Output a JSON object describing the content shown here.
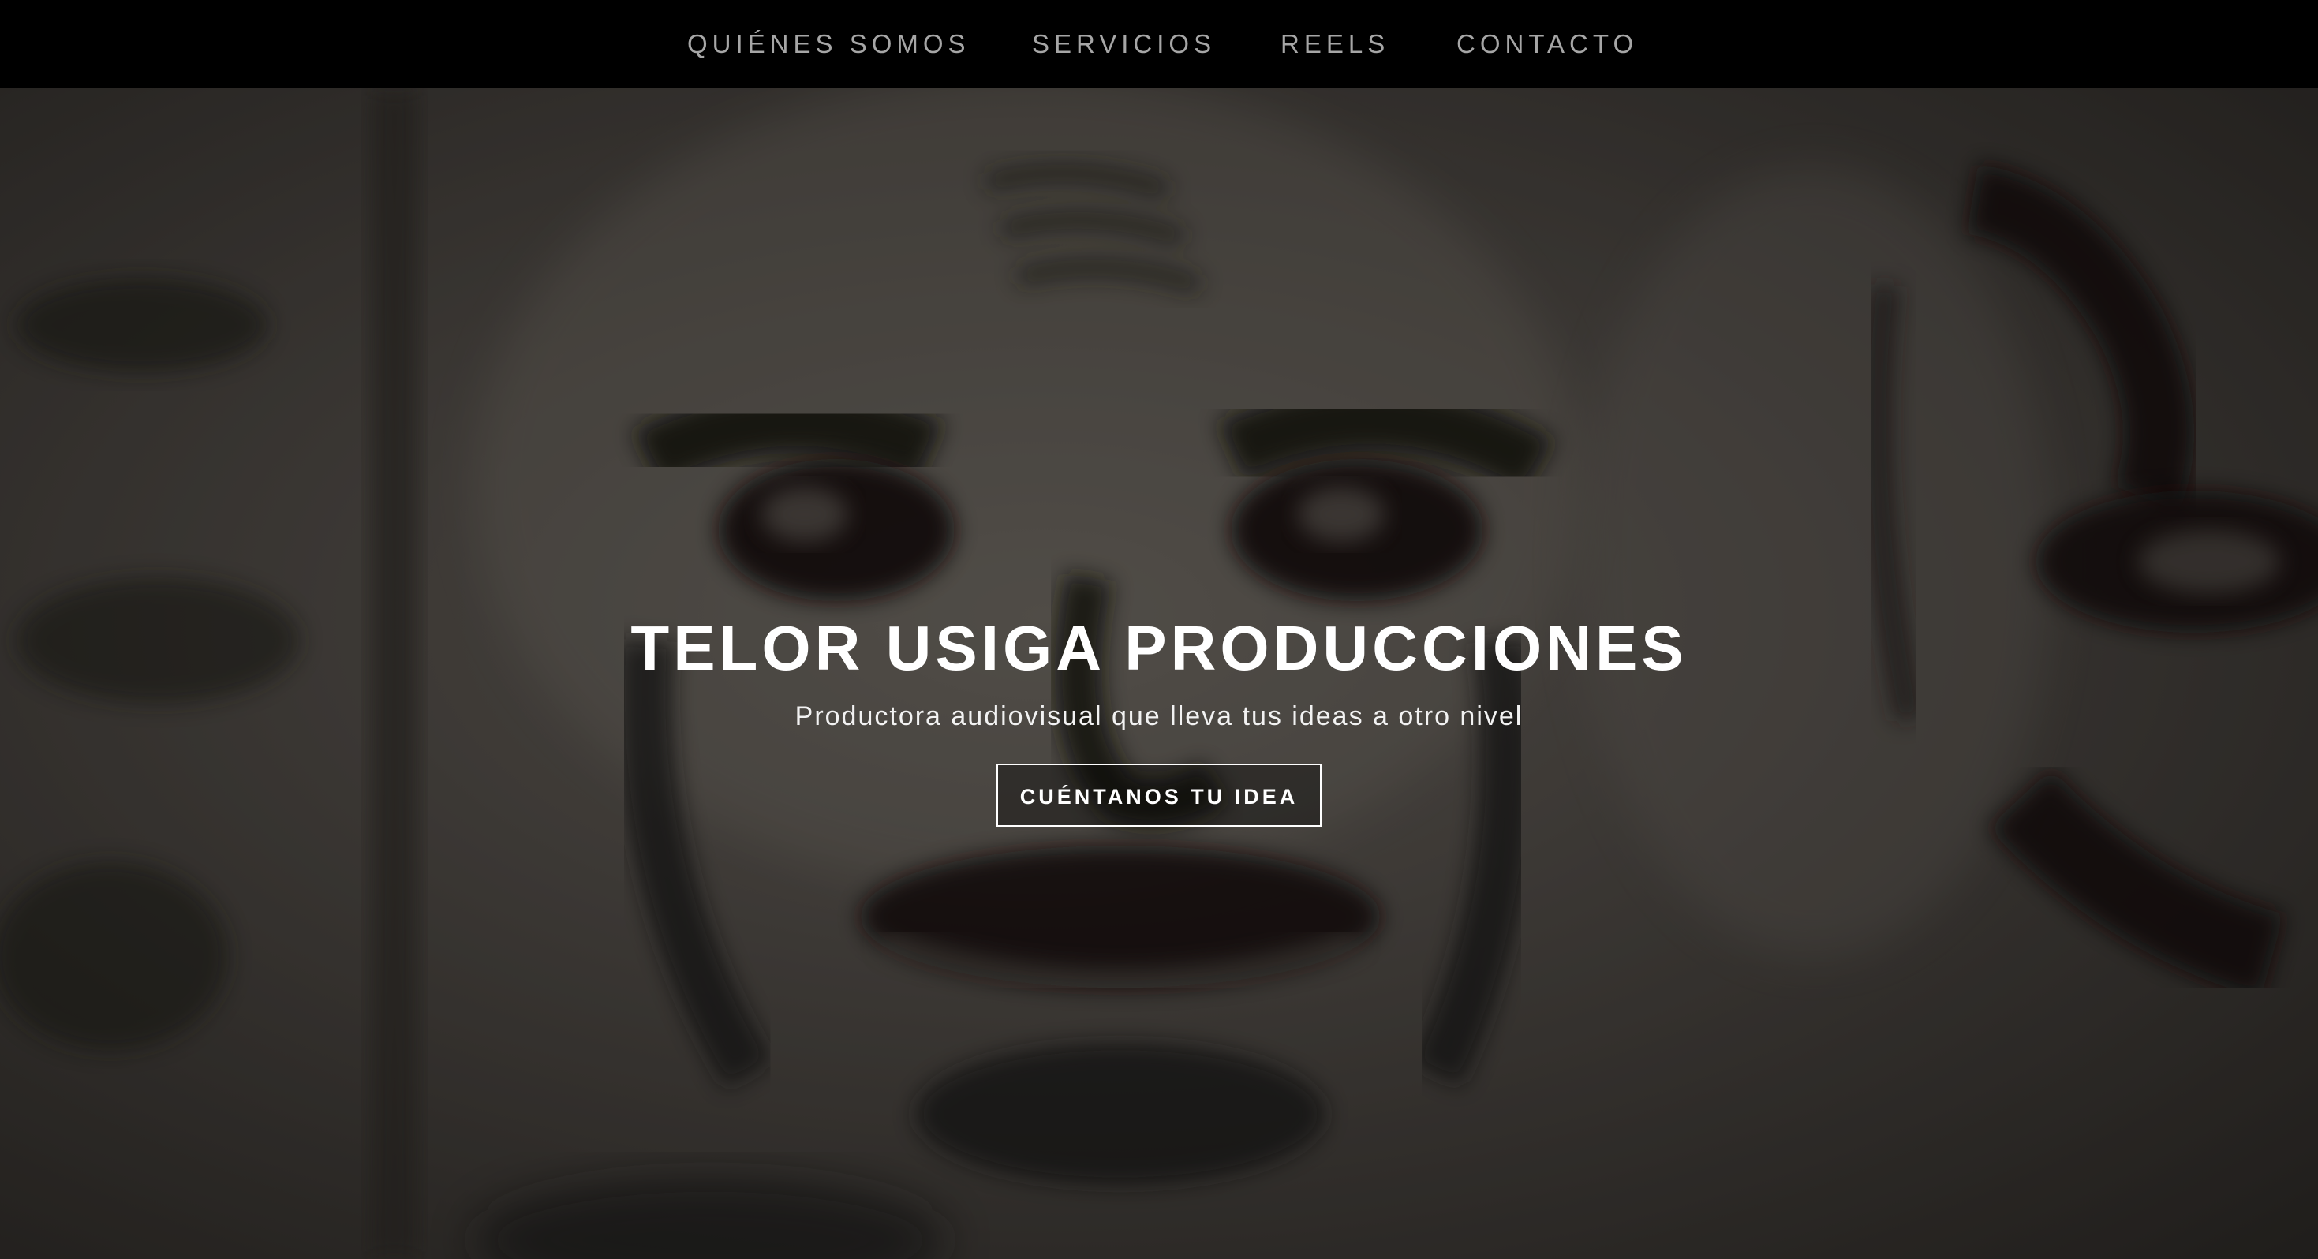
{
  "nav": {
    "items": [
      {
        "label": "QUIÉNES SOMOS"
      },
      {
        "label": "SERVICIOS"
      },
      {
        "label": "REELS"
      },
      {
        "label": "CONTACTO"
      }
    ]
  },
  "hero": {
    "title": "TELOR USIGA PRODUCCIONES",
    "subtitle": "Productora audiovisual que lleva tus ideas a otro nivel",
    "cta_label": "CUÉNTANOS TU IDEA",
    "background": "graffiti-face-wall-image"
  },
  "colors": {
    "nav_background": "#000000",
    "nav_text": "#a6a6a6",
    "hero_text": "#ffffff"
  }
}
